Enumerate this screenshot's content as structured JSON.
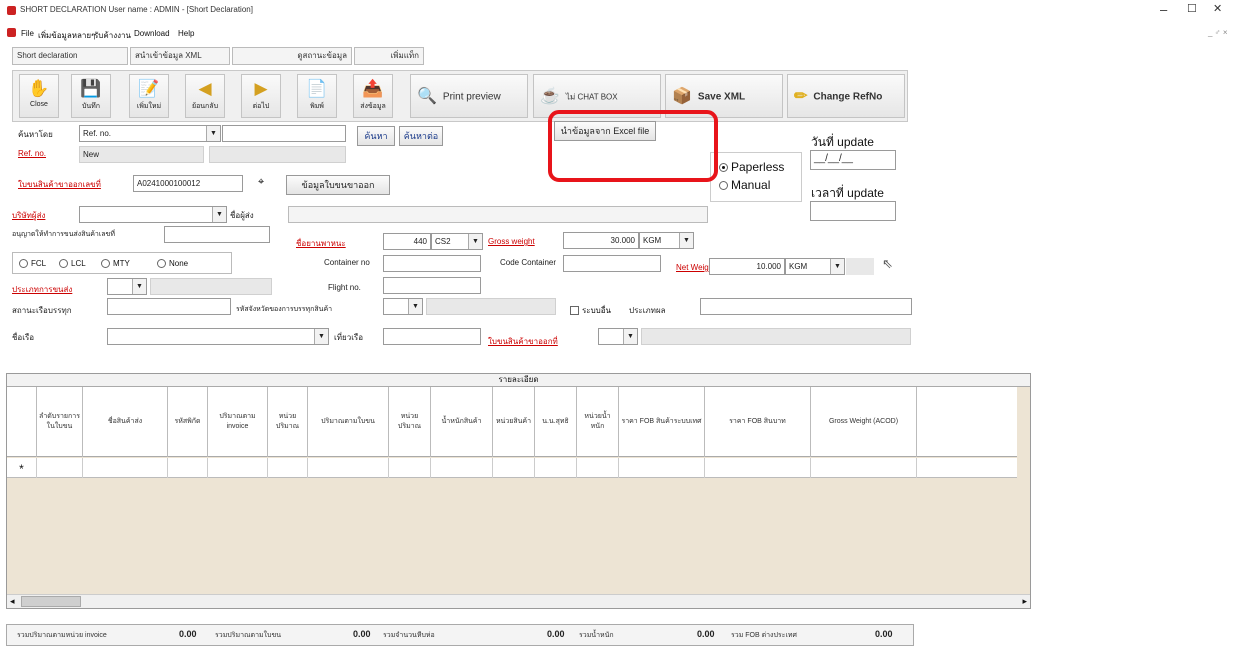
{
  "window": {
    "title": "SHORT DECLARATION   User name : ADMIN - [Short Declaration]",
    "controls": [
      "–",
      "☐",
      "✕"
    ],
    "mdi_controls": "_ ♂ ×"
  },
  "menu": [
    "File",
    "เพิ่มข้อมูลหลายๆ",
    "รับค้างงาน",
    "Download",
    "Help"
  ],
  "tabs": [
    "Short declaration",
    "สนำเข้าข้อมูล XML",
    "ดูสถานะข้อมูล",
    "เพิ่มแท็ก"
  ],
  "toolbar": {
    "buttons": [
      {
        "label": "Close",
        "icon": "✋"
      },
      {
        "label": "บันทึก",
        "icon": "💾"
      },
      {
        "label": "เพิ่มใหม่",
        "icon": "📝"
      },
      {
        "label": "ย้อนกลับ",
        "icon": "◀"
      },
      {
        "label": "ต่อไป",
        "icon": "▶"
      },
      {
        "label": "พิมพ์",
        "icon": "📄"
      },
      {
        "label": "ส่งข้อมูล",
        "icon": "📤"
      }
    ],
    "print_preview": "Print preview",
    "chat_box": "ไม่ CHAT BOX",
    "save_xml": "Save XML",
    "change_refno": "Change RefNo"
  },
  "form": {
    "search_label": "ค้นหาโดย",
    "search_by_value": "Ref. no.",
    "search_value": "",
    "find_button": "ค้นหา",
    "find_other_button": "ค้นหาต่อ",
    "import_excel_button": "นำข้อมูลจาก Excel file",
    "refno_label": "Ref. no.",
    "refno_value": "New",
    "declaration_label": "ใบขนสินค้าขาออกเลขที่",
    "declaration_value": "A0241000100012",
    "export_data_button": "ข้อมูลใบขนขาออก",
    "company_label": "บริษัทผู้ส่ง",
    "company_name_label": "ชื่อผู้ส่ง",
    "permit_label": "อนุญาตให้ทำการขนส่งสินค้าเลขที่",
    "vessel_label": "ชื่อยานพาหนะ",
    "package_qty": "440",
    "package_unit": "CS2",
    "gross_weight_label": "Gross weight",
    "gross_weight_value": "30.000",
    "gross_weight_unit": "KGM",
    "fcl_label": "FCL",
    "lcl_label": "LCL",
    "mty_label": "MTY",
    "none_label": "None",
    "container_label": "Container no",
    "code_container_label": "Code Container",
    "net_weight_label": "Net Weight",
    "net_weight_value": "10.000",
    "net_weight_unit": "KGM",
    "transport_label": "ประเภทการขนส่ง",
    "flight_label": "Flight no.",
    "port_label": "สถานะเรือบรรทุก",
    "loading_code_label": "รหัสจังหวัดของการบรรทุกสินค้า",
    "other_check_label": "ระบบอื่น",
    "reason_label": "ประเภทผล",
    "ship_label": "ชื่อเรือ",
    "voyage_label": "เที่ยวเรือ",
    "declaration_type_label": "ใบขนสินค้าขาออกที่"
  },
  "mode": {
    "paperless": "Paperless",
    "manual": "Manual",
    "selected": "Paperless"
  },
  "update": {
    "date_label": "วันที่ update",
    "date_value": "__/__/__",
    "time_label": "เวลาที่ update"
  },
  "grid": {
    "title": "รายละเอียด",
    "columns": [
      "ลำดับรายการในใบขน",
      "ชื่อสินค้าส่ง",
      "รหัสพิกัด",
      "ปริมาณตาม invoice",
      "หน่วยปริมาณ",
      "ปริมาณตามใบขน",
      "หน่วยปริมาณ",
      "น้ำหนักสินค้า",
      "หน่วยสินค้า",
      "น.น.สุทธิ",
      "หน่วยน้ำหนัก",
      "ราคา FOB สินค้าระบบเทศ",
      "ราคา FOB สินบาท",
      "Gross Weight (ACOD)"
    ],
    "new_row_marker": "*"
  },
  "summary": [
    {
      "label": "รวมปริมาณตามหน่วย invoice",
      "value": "0.00"
    },
    {
      "label": "รวมปริมาณตามใบขน",
      "value": "0.00"
    },
    {
      "label": "รวมจำนวนหีบห่อ",
      "value": "0.00"
    },
    {
      "label": "รวมน้ำหนัก",
      "value": "0.00"
    },
    {
      "label": "รวม FOB ต่างประเทศ",
      "value": "0.00"
    }
  ]
}
